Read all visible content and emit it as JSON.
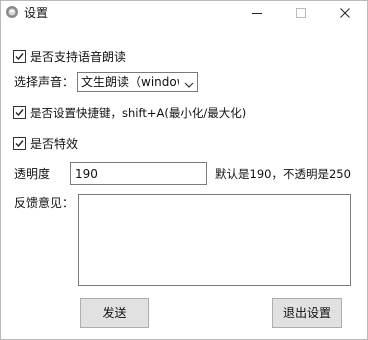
{
  "window": {
    "title": "设置"
  },
  "options": {
    "voice_read_label": "是否支持语音朗读",
    "voice_read_checked": true,
    "voice_select_label": "选择声音：",
    "voice_select_value": "文生朗读（window",
    "shortcut_label": "是否设置快捷键，shift+A(最小化/最大化)",
    "shortcut_checked": true,
    "effects_label": "是否特效",
    "effects_checked": true
  },
  "opacity": {
    "label": "透明度",
    "value": "190",
    "hint": "默认是190，不透明是250"
  },
  "feedback": {
    "label": "反馈意见：",
    "value": ""
  },
  "buttons": {
    "send": "发送",
    "exit": "退出设置"
  }
}
